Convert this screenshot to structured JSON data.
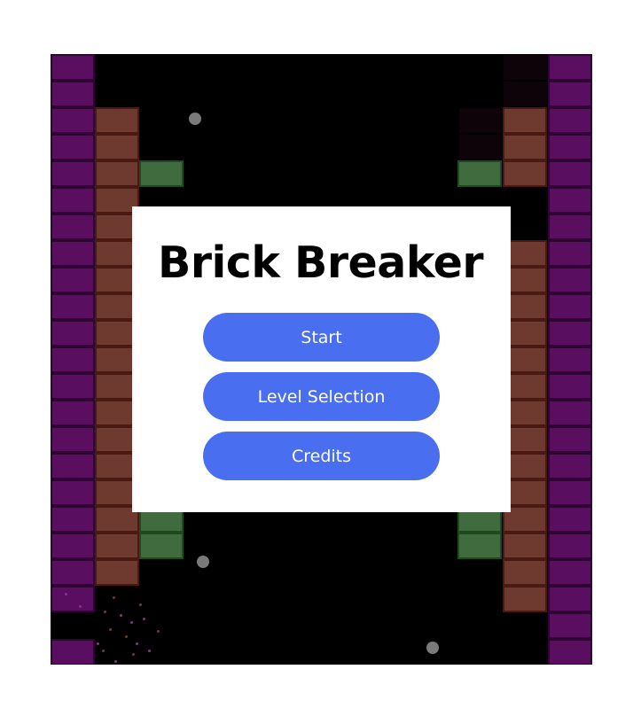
{
  "game": {
    "title": "Brick Breaker"
  },
  "menu": {
    "buttons": [
      {
        "label": "Start"
      },
      {
        "label": "Level Selection"
      },
      {
        "label": "Credits"
      }
    ]
  },
  "colors": {
    "background": "#000000",
    "wall_brick": "#5a0e5f",
    "brown_brick": "#6e3a2f",
    "green_brick": "#3f6b3f",
    "ball": "#7a7a7a",
    "button": "#4a6ef0",
    "panel": "#ffffff"
  }
}
